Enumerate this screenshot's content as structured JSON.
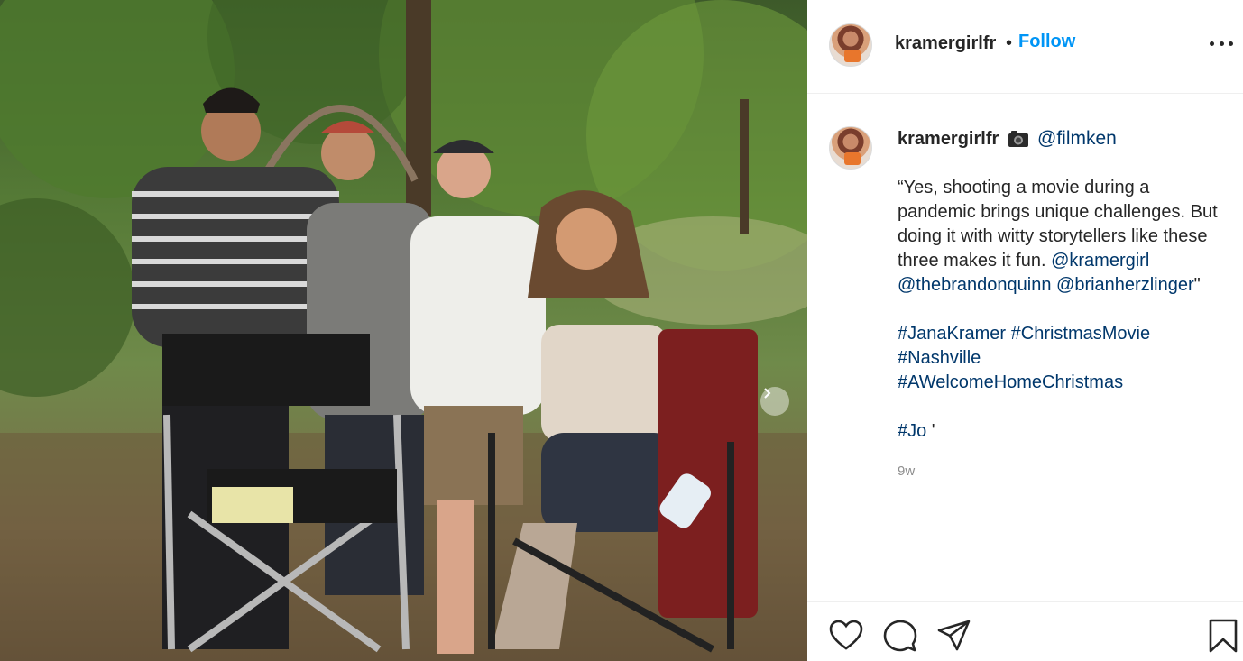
{
  "post": {
    "username": "kramergirlfr",
    "separator": "•",
    "follow_label": "Follow",
    "more_icon": "more-options-icon",
    "caption": {
      "username": "kramergirlfr",
      "camera_icon": "camera-emoji-icon",
      "credit_mention": "@filmken",
      "line1": "“Yes, shooting a movie during a pandemic brings unique challenges. But doing it with witty storytellers like these three makes it fun. ",
      "mention1": "@kramergirl",
      "mention2": "@thebrandonquinn",
      "mention3": "@brianherzlinger",
      "quote_end": "\"",
      "hashtag1": "#JanaKramer",
      "hashtag2": "#ChristmasMovie",
      "hashtag3": "#Nashville",
      "hashtag4": "#AWelcomeHomeChristmas",
      "hashtag5": "#Jo",
      "tail": " '"
    },
    "timestamp": "9w"
  },
  "actions": {
    "like": "heart-icon",
    "comment": "comment-icon",
    "share": "share-icon",
    "save": "bookmark-icon"
  },
  "colors": {
    "link": "#00376b",
    "follow": "#0095f6",
    "text": "#262626",
    "muted": "#8e8e8e"
  }
}
